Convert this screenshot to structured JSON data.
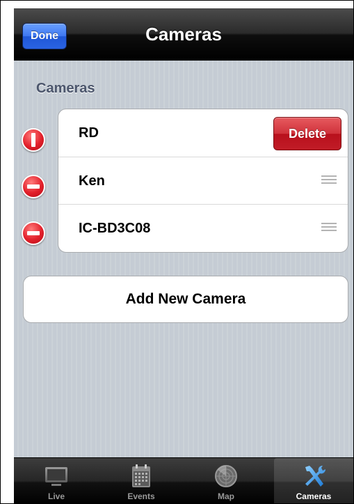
{
  "navbar": {
    "title": "Cameras",
    "done_label": "Done"
  },
  "section": {
    "header": "Cameras"
  },
  "cameras": [
    {
      "name": "RD",
      "state": "delete-confirm"
    },
    {
      "name": "Ken",
      "state": "editing"
    },
    {
      "name": "IC-BD3C08",
      "state": "editing"
    }
  ],
  "delete_label": "Delete",
  "add_camera_label": "Add New Camera",
  "tabs": [
    {
      "label": "Live",
      "icon": "monitor-icon",
      "selected": false
    },
    {
      "label": "Events",
      "icon": "calendar-icon",
      "selected": false
    },
    {
      "label": "Map",
      "icon": "radar-icon",
      "selected": false
    },
    {
      "label": "Cameras",
      "icon": "tools-icon",
      "selected": true
    }
  ],
  "colors": {
    "delete_red": "#c11c27",
    "done_blue": "#2a63e3",
    "section_header": "#4c566c"
  }
}
